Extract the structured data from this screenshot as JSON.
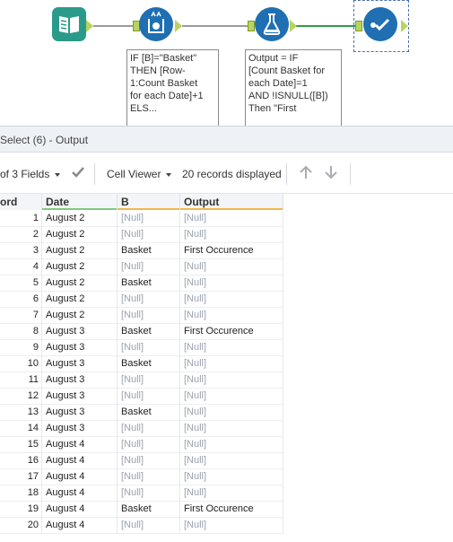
{
  "canvas": {
    "note_formula_1": "IF [B]=\"Basket\"\nTHEN [Row-\n1:Count Basket\nfor each Date]+1\nELS...",
    "note_formula_2": "Output = IF\n[Count Basket for\neach Date]=1\nAND !ISNULL([B])\nThen \"First"
  },
  "results": {
    "title": "Select (6) - Output",
    "fields_label": "of 3 Fields",
    "viewer_label": "Cell Viewer",
    "records_label": "20 records displayed"
  },
  "grid": {
    "columns": [
      "ord",
      "Date",
      "B",
      "Output"
    ],
    "colors": {
      "date": "#7fc97f",
      "b": "#f2b84b",
      "output": "#f2b84b"
    },
    "rows": [
      {
        "n": "1",
        "date": "August 2",
        "b": "[Null]",
        "out": "[Null]"
      },
      {
        "n": "2",
        "date": "August 2",
        "b": "[Null]",
        "out": "[Null]"
      },
      {
        "n": "3",
        "date": "August 2",
        "b": "Basket",
        "out": "First Occurence"
      },
      {
        "n": "4",
        "date": "August 2",
        "b": "[Null]",
        "out": "[Null]"
      },
      {
        "n": "5",
        "date": "August 2",
        "b": "Basket",
        "out": "[Null]"
      },
      {
        "n": "6",
        "date": "August 2",
        "b": "[Null]",
        "out": "[Null]"
      },
      {
        "n": "7",
        "date": "August 2",
        "b": "[Null]",
        "out": "[Null]"
      },
      {
        "n": "8",
        "date": "August 3",
        "b": "Basket",
        "out": "First Occurence"
      },
      {
        "n": "9",
        "date": "August 3",
        "b": "[Null]",
        "out": "[Null]"
      },
      {
        "n": "10",
        "date": "August 3",
        "b": "Basket",
        "out": "[Null]"
      },
      {
        "n": "11",
        "date": "August 3",
        "b": "[Null]",
        "out": "[Null]"
      },
      {
        "n": "12",
        "date": "August 3",
        "b": "[Null]",
        "out": "[Null]"
      },
      {
        "n": "13",
        "date": "August 3",
        "b": "Basket",
        "out": "[Null]"
      },
      {
        "n": "14",
        "date": "August 3",
        "b": "[Null]",
        "out": "[Null]"
      },
      {
        "n": "15",
        "date": "August 4",
        "b": "[Null]",
        "out": "[Null]"
      },
      {
        "n": "16",
        "date": "August 4",
        "b": "[Null]",
        "out": "[Null]"
      },
      {
        "n": "17",
        "date": "August 4",
        "b": "[Null]",
        "out": "[Null]"
      },
      {
        "n": "18",
        "date": "August 4",
        "b": "[Null]",
        "out": "[Null]"
      },
      {
        "n": "19",
        "date": "August 4",
        "b": "Basket",
        "out": "First Occurence"
      },
      {
        "n": "20",
        "date": "August 4",
        "b": "[Null]",
        "out": "[Null]"
      }
    ]
  }
}
